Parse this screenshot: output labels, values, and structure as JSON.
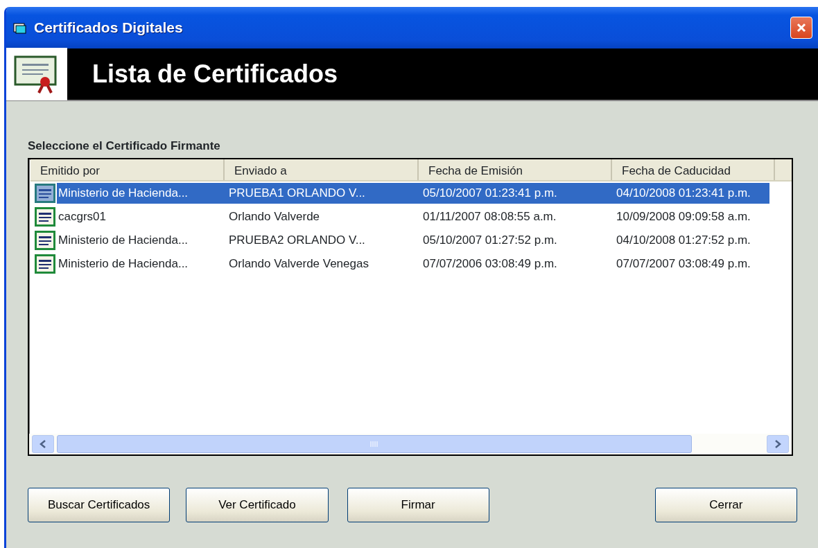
{
  "window": {
    "title": "Certificados Digitales"
  },
  "header": {
    "title": "Lista de Certificados"
  },
  "list_label": "Seleccione el Certificado Firmante",
  "table": {
    "columns": [
      "Emitido por",
      "Enviado a",
      "Fecha de Emisión",
      "Fecha de Caducidad"
    ],
    "rows": [
      {
        "selected": true,
        "cells": [
          "Ministerio de Hacienda...",
          "PRUEBA1 ORLANDO V...",
          "05/10/2007 01:23:41 p.m.",
          "04/10/2008 01:23:41 p.m."
        ]
      },
      {
        "selected": false,
        "cells": [
          "cacgrs01",
          "Orlando Valverde",
          "01/11/2007 08:08:55 a.m.",
          "10/09/2008 09:09:58 a.m."
        ]
      },
      {
        "selected": false,
        "cells": [
          "Ministerio de Hacienda...",
          "PRUEBA2  ORLANDO V...",
          "05/10/2007 01:27:52 p.m.",
          "04/10/2008 01:27:52 p.m."
        ]
      },
      {
        "selected": false,
        "cells": [
          "Ministerio de Hacienda...",
          "Orlando Valverde Venegas",
          "07/07/2006 03:08:49 p.m.",
          "07/07/2007 03:08:49 p.m."
        ]
      }
    ]
  },
  "buttons": [
    "Buscar Certificados",
    "Ver Certificado",
    "Firmar",
    "Cerrar"
  ]
}
